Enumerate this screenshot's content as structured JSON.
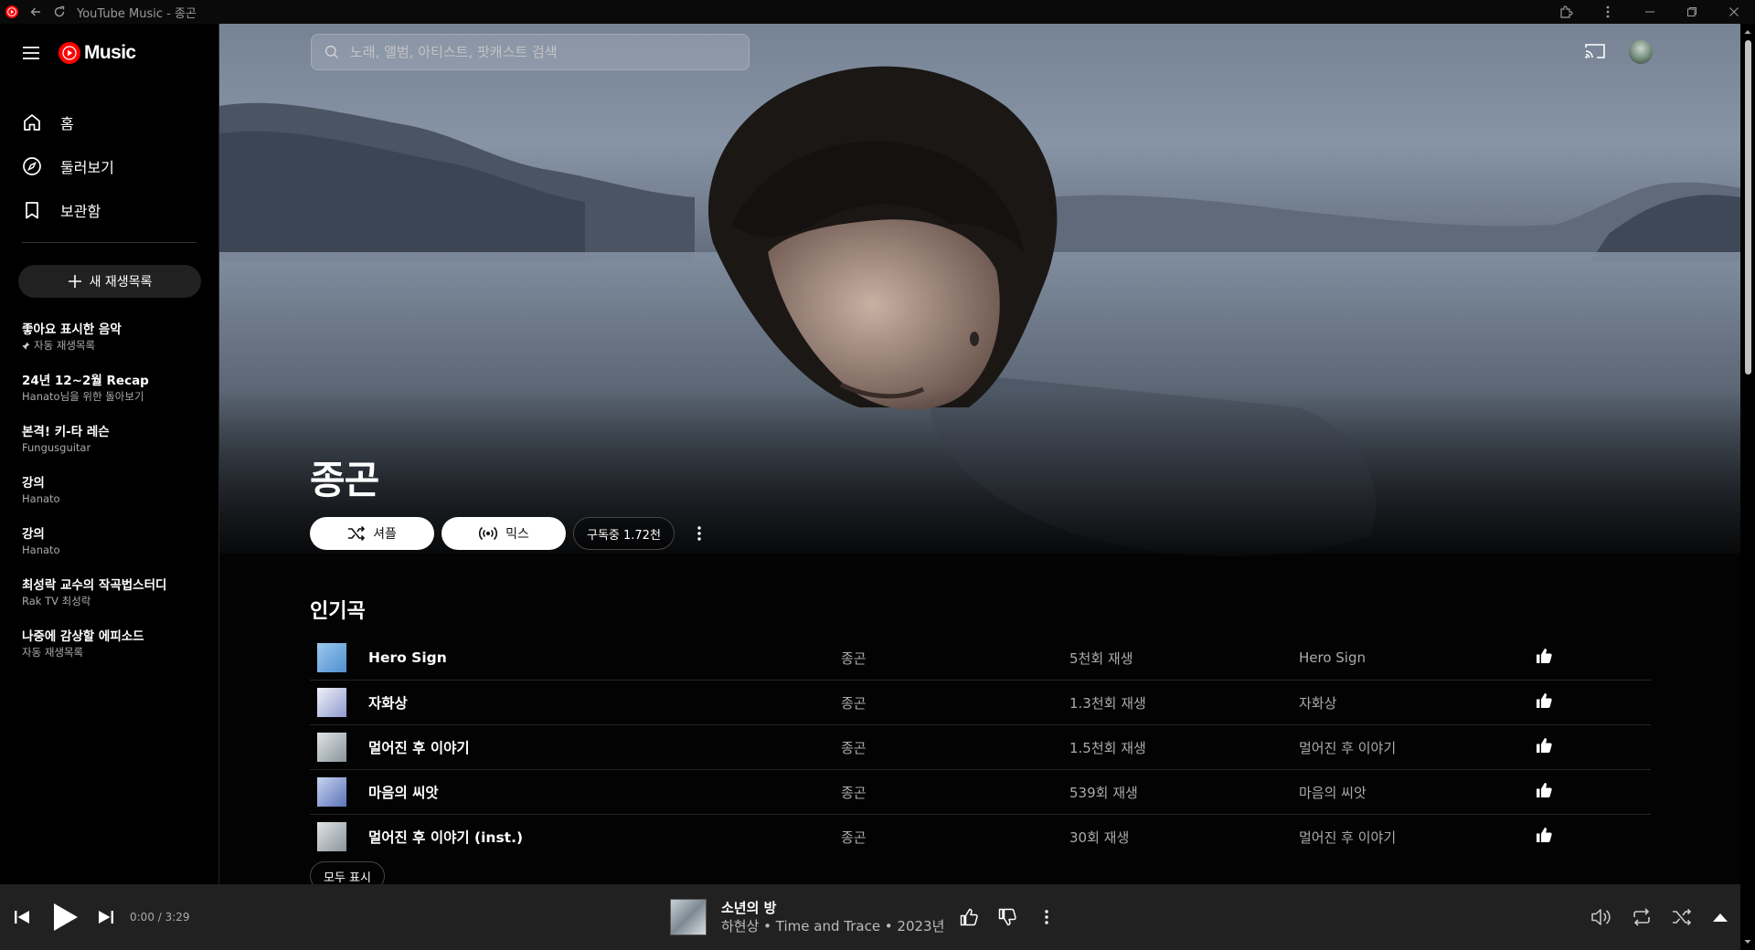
{
  "window": {
    "title": "YouTube Music - 종곤"
  },
  "brand": {
    "logo_text": "Music",
    "accent": "#ff0000"
  },
  "nav": [
    {
      "label": "홈",
      "icon": "home-icon"
    },
    {
      "label": "둘러보기",
      "icon": "compass-icon"
    },
    {
      "label": "보관함",
      "icon": "bookmark-icon"
    }
  ],
  "new_playlist": {
    "label": "새 재생목록"
  },
  "playlists": [
    {
      "title": "좋아요 표시한 음악",
      "sub": "자동 재생목록",
      "pinned": true
    },
    {
      "title": "24년 12~2월 Recap",
      "sub": "Hanato님을 위한 돌아보기"
    },
    {
      "title": "본격! 키-타 레슨",
      "sub": "Fungusguitar"
    },
    {
      "title": "강의",
      "sub": "Hanato"
    },
    {
      "title": "강의",
      "sub": "Hanato"
    },
    {
      "title": "최성락 교수의 작곡법스터디",
      "sub": "Rak TV 최성락"
    },
    {
      "title": "나중에 감상할 에피소드",
      "sub": "자동 재생목록"
    }
  ],
  "search": {
    "placeholder": "노래, 앨범, 아티스트, 팟캐스트 검색"
  },
  "artist": {
    "name": "종곤",
    "shuffle_label": "셔플",
    "mix_label": "믹스",
    "subscribe_label": "구독중 1.72천"
  },
  "popular": {
    "title": "인기곡",
    "show_all": "모두 표시",
    "songs": [
      {
        "title": "Hero Sign",
        "artist": "종곤",
        "plays": "5천회 재생",
        "album": "Hero Sign",
        "thumb": [
          "#9cc8ee",
          "#4e8fd0"
        ]
      },
      {
        "title": "자화상",
        "artist": "종곤",
        "plays": "1.3천회 재생",
        "album": "자화상",
        "thumb": [
          "#f0f2f8",
          "#8f9ad0"
        ]
      },
      {
        "title": "멀어진 후 이야기",
        "artist": "종곤",
        "plays": "1.5천회 재생",
        "album": "멀어진 후 이야기",
        "thumb": [
          "#dfe3e6",
          "#8a949b"
        ]
      },
      {
        "title": "마음의 씨앗",
        "artist": "종곤",
        "plays": "539회 재생",
        "album": "마음의 씨앗",
        "thumb": [
          "#c6d3f0",
          "#5b73b8"
        ]
      },
      {
        "title": "멀어진 후 이야기 (inst.)",
        "artist": "종곤",
        "plays": "30회 재생",
        "album": "멀어진 후 이야기",
        "thumb": [
          "#dfe3e6",
          "#8a949b"
        ]
      }
    ]
  },
  "player": {
    "time": "0:00 / 3:29",
    "title": "소년의 방",
    "subtitle": "하현상 • Time and Trace • 2023년"
  }
}
